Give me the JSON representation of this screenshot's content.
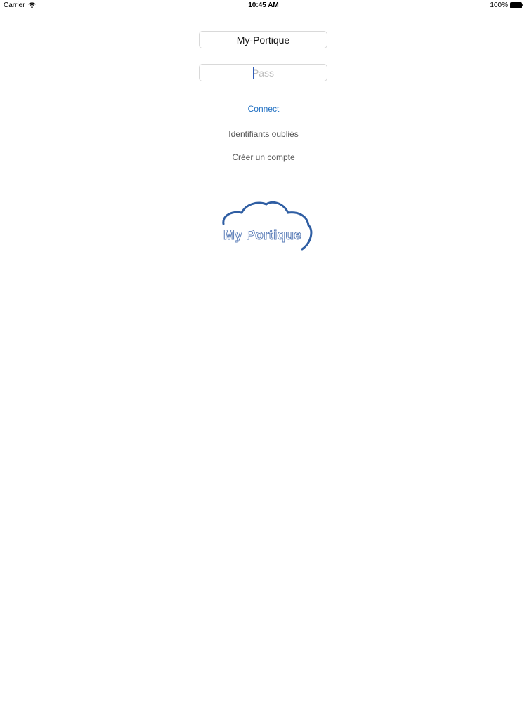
{
  "status_bar": {
    "carrier": "Carrier",
    "time": "10:45 AM",
    "battery": "100%"
  },
  "login": {
    "username_value": "My-Portique",
    "password_placeholder": "Pass",
    "connect_label": "Connect",
    "forgot_label": "Identifiants oubliés",
    "create_account_label": "Créer un compte"
  },
  "logo": {
    "text": "My Portique",
    "icon": "cloud-logo-icon"
  },
  "colors": {
    "link_blue": "#1f6fc2",
    "logo_blue": "#2f5ea3"
  }
}
